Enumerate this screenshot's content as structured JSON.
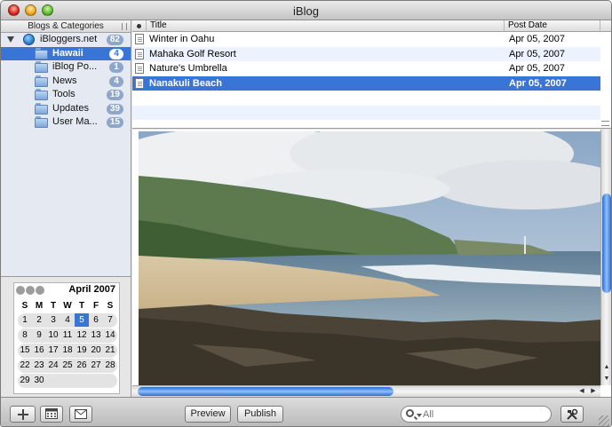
{
  "window": {
    "title": "iBlog"
  },
  "sidebar": {
    "header": "Blogs & Categories",
    "root": {
      "label": "iBloggers.net",
      "count": "82"
    },
    "items": [
      {
        "label": "Hawaii",
        "count": "4",
        "selected": true
      },
      {
        "label": "iBlog Po...",
        "count": "1"
      },
      {
        "label": "News",
        "count": "4"
      },
      {
        "label": "Tools",
        "count": "19"
      },
      {
        "label": "Updates",
        "count": "39"
      },
      {
        "label": "User Ma...",
        "count": "15"
      }
    ]
  },
  "calendar": {
    "month": "April 2007",
    "weekdays": [
      "S",
      "M",
      "T",
      "W",
      "T",
      "F",
      "S"
    ],
    "weeks": [
      [
        "1",
        "2",
        "3",
        "4",
        "5",
        "6",
        "7"
      ],
      [
        "8",
        "9",
        "10",
        "11",
        "12",
        "13",
        "14"
      ],
      [
        "15",
        "16",
        "17",
        "18",
        "19",
        "20",
        "21"
      ],
      [
        "22",
        "23",
        "24",
        "25",
        "26",
        "27",
        "28"
      ],
      [
        "29",
        "30",
        "",
        "",
        "",
        "",
        ""
      ]
    ],
    "today": "5"
  },
  "postlist": {
    "columns": {
      "title": "Title",
      "date": "Post Date"
    },
    "rows": [
      {
        "title": "Winter in Oahu",
        "date": "Apr 05, 2007"
      },
      {
        "title": "Mahaka Golf Resort",
        "date": "Apr 05, 2007"
      },
      {
        "title": "Nature's Umbrella",
        "date": "Apr 05, 2007"
      },
      {
        "title": "Nanakuli Beach",
        "date": "Apr 05, 2007",
        "selected": true
      }
    ]
  },
  "toolbar": {
    "preview_label": "Preview",
    "publish_label": "Publish",
    "search_placeholder": "All"
  },
  "colors": {
    "selection": "#3875d7",
    "badge": "#8ea6c9",
    "scroll_thumb": "#2b6ad0"
  },
  "icons": {
    "add": "plus-icon",
    "calendar": "calendar-icon",
    "mail": "mail-icon",
    "tools": "tools-icon",
    "search": "search-icon"
  }
}
